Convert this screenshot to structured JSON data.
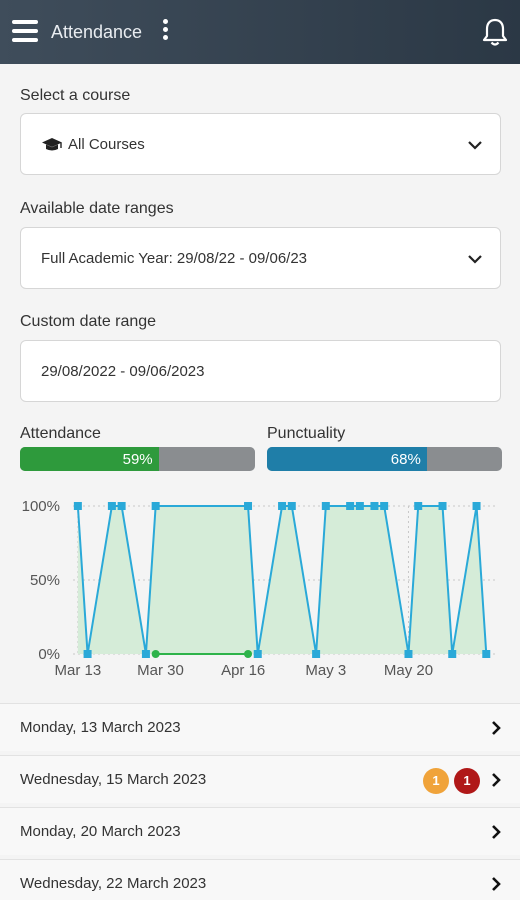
{
  "header": {
    "title": "Attendance"
  },
  "course": {
    "label": "Select a course",
    "value": "All Courses"
  },
  "date_ranges": {
    "label": "Available date ranges",
    "value": "Full Academic Year: 29/08/22 - 09/06/23"
  },
  "custom_range": {
    "label": "Custom date range",
    "value": "29/08/2022 - 09/06/2023"
  },
  "attendance": {
    "label": "Attendance",
    "percent_text": "59%",
    "percent": 59,
    "color": "#2e9a3c"
  },
  "punctuality": {
    "label": "Punctuality",
    "percent_text": "68%",
    "percent": 68,
    "color": "#1f7ea8"
  },
  "chart_data": {
    "type": "line",
    "y_ticks": [
      "100%",
      "50%",
      "0%"
    ],
    "x_ticks": [
      "Mar 13",
      "Mar 30",
      "Apr 16",
      "May 3",
      "May 20"
    ],
    "x_tick_days": [
      0,
      17,
      34,
      51,
      68
    ],
    "ylim": [
      0,
      100
    ],
    "xlim_days": [
      -1,
      86
    ],
    "grid": true,
    "series": [
      {
        "type": "area-line",
        "color": "#2aa9d8",
        "fill": "#d5ecd8",
        "points": [
          [
            0,
            100
          ],
          [
            2,
            0
          ],
          [
            7,
            100
          ],
          [
            9,
            100
          ],
          [
            14,
            0
          ],
          [
            16,
            100
          ],
          [
            35,
            100
          ],
          [
            37,
            0
          ],
          [
            42,
            100
          ],
          [
            44,
            100
          ],
          [
            49,
            0
          ],
          [
            51,
            100
          ],
          [
            56,
            100
          ],
          [
            58,
            100
          ],
          [
            61,
            100
          ],
          [
            63,
            100
          ],
          [
            68,
            0
          ],
          [
            70,
            100
          ],
          [
            75,
            100
          ],
          [
            77,
            0
          ],
          [
            82,
            100
          ],
          [
            84,
            0
          ]
        ]
      },
      {
        "type": "line",
        "color": "#2eb34a",
        "points": [
          [
            16,
            0
          ],
          [
            35,
            0
          ]
        ]
      }
    ]
  },
  "days": [
    {
      "label": "Monday, 13 March 2023",
      "badges": []
    },
    {
      "label": "Wednesday, 15 March 2023",
      "badges": [
        {
          "text": "1",
          "color": "#f0a33a"
        },
        {
          "text": "1",
          "color": "#b01818"
        }
      ]
    },
    {
      "label": "Monday, 20 March 2023",
      "badges": []
    },
    {
      "label": "Wednesday, 22 March 2023",
      "badges": []
    }
  ]
}
